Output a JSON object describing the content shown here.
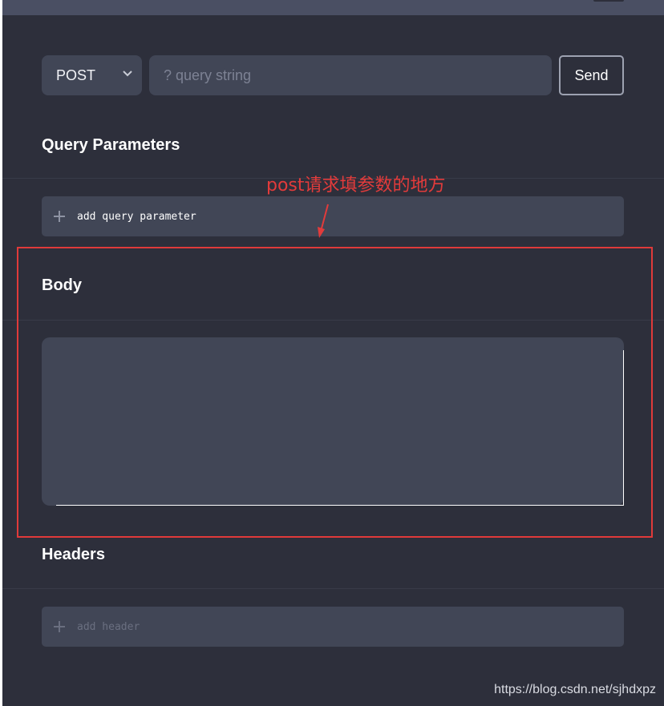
{
  "request": {
    "method": "POST",
    "query_placeholder": "? query string",
    "send_label": "Send"
  },
  "sections": {
    "query_parameters": {
      "title": "Query Parameters",
      "add_label": "add query parameter"
    },
    "body": {
      "title": "Body"
    },
    "headers": {
      "title": "Headers",
      "add_label": "add header"
    }
  },
  "annotation": {
    "note": "post请求填参数的地方",
    "color": "#e23b3b"
  },
  "watermark": "https://blog.csdn.net/sjhdxpz",
  "colors": {
    "background": "#2d2f3b",
    "field": "#414656",
    "text": "#ffffff",
    "muted": "#7d8294"
  },
  "icons": {
    "method_dropdown": "chevron-down-icon",
    "add": "plus-icon"
  }
}
